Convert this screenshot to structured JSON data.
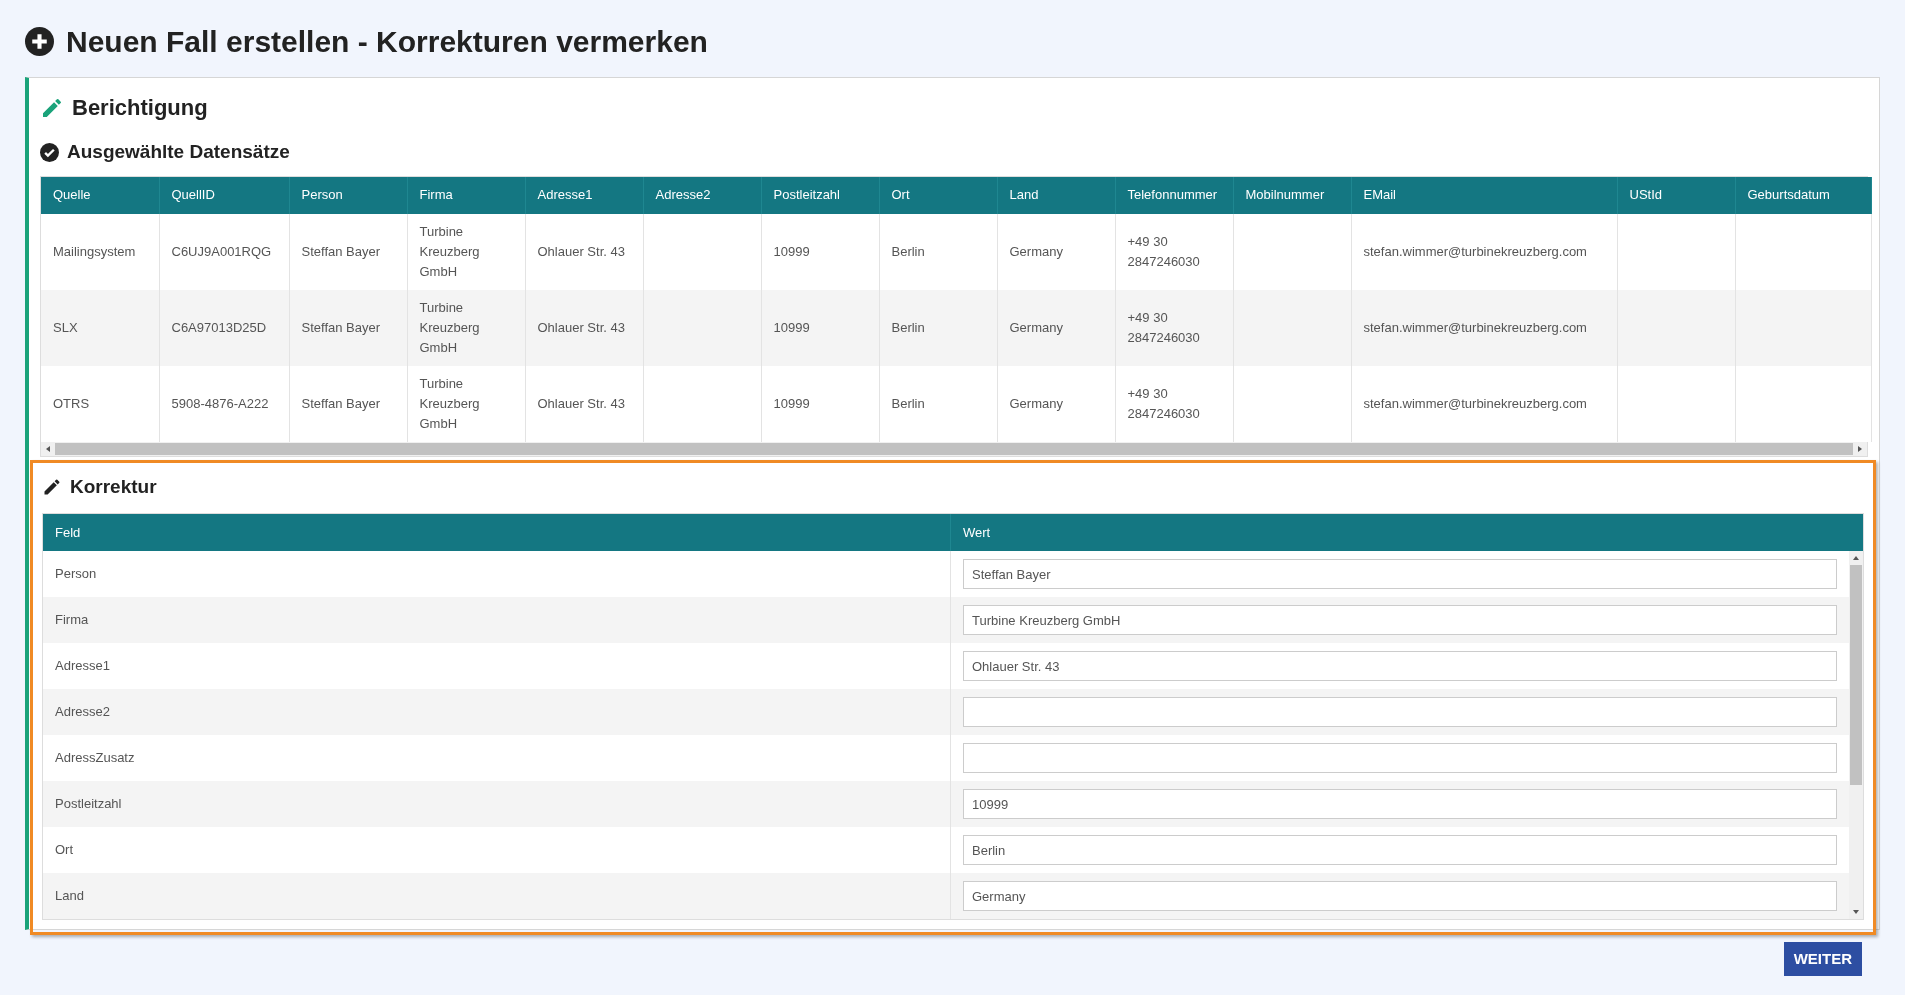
{
  "page_title": "Neuen Fall erstellen - Korrekturen vermerken",
  "berichtigung": {
    "title": "Berichtigung",
    "records_title": "Ausgewählte Datensätze",
    "columns": [
      "Quelle",
      "QuellID",
      "Person",
      "Firma",
      "Adresse1",
      "Adresse2",
      "Postleitzahl",
      "Ort",
      "Land",
      "Telefonnummer",
      "Mobilnummer",
      "EMail",
      "UStId",
      "Geburtsdatum"
    ],
    "rows": [
      [
        "Mailingsystem",
        "C6UJ9A001RQG",
        "Steffan Bayer",
        "Turbine Kreuzberg GmbH",
        "Ohlauer Str. 43",
        "",
        "10999",
        "Berlin",
        "Germany",
        "+49 30 2847246030",
        "",
        "stefan.wimmer@turbinekreuzberg.com",
        "",
        ""
      ],
      [
        "SLX",
        "C6A97013D25D",
        "Steffan Bayer",
        "Turbine Kreuzberg GmbH",
        "Ohlauer Str. 43",
        "",
        "10999",
        "Berlin",
        "Germany",
        "+49 30 2847246030",
        "",
        "stefan.wimmer@turbinekreuzberg.com",
        "",
        ""
      ],
      [
        "OTRS",
        "5908-4876-A222",
        "Steffan Bayer",
        "Turbine Kreuzberg GmbH",
        "Ohlauer Str. 43",
        "",
        "10999",
        "Berlin",
        "Germany",
        "+49 30 2847246030",
        "",
        "stefan.wimmer@turbinekreuzberg.com",
        "",
        ""
      ]
    ]
  },
  "korrektur": {
    "title": "Korrektur",
    "columns": [
      "Feld",
      "Wert"
    ],
    "rows": [
      {
        "field": "Person",
        "value": "Steffan Bayer"
      },
      {
        "field": "Firma",
        "value": "Turbine Kreuzberg GmbH"
      },
      {
        "field": "Adresse1",
        "value": "Ohlauer Str. 43"
      },
      {
        "field": "Adresse2"
      },
      {
        "field": "AdressZusatz"
      },
      {
        "field": "Postleitzahl",
        "value": "10999"
      },
      {
        "field": "Ort",
        "value": "Berlin"
      },
      {
        "field": "Land",
        "value": "Germany"
      }
    ]
  },
  "button": "WEITER"
}
